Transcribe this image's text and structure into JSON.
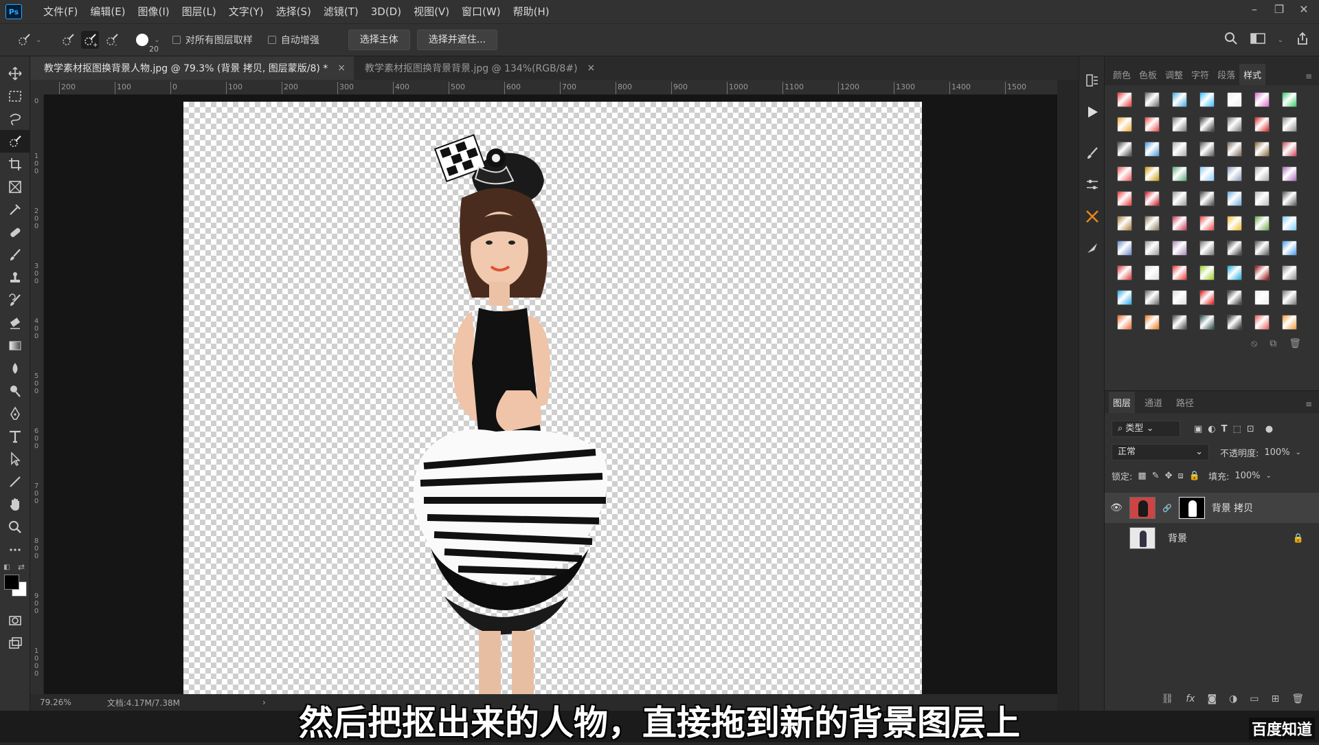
{
  "app": {
    "logo": "Ps"
  },
  "menu": [
    "文件(F)",
    "编辑(E)",
    "图像(I)",
    "图层(L)",
    "文字(Y)",
    "选择(S)",
    "滤镜(T)",
    "3D(D)",
    "视图(V)",
    "窗口(W)",
    "帮助(H)"
  ],
  "options": {
    "brush_size": "20",
    "sample_all_layers": "对所有图层取样",
    "auto_enhance": "自动增强",
    "select_subject": "选择主体",
    "select_and_mask": "选择并遮住..."
  },
  "tabs": [
    {
      "title": "教学素材抠图换背景人物.jpg @ 79.3% (背景 拷贝, 图层蒙版/8) *",
      "close": "×"
    },
    {
      "title": "教学素材抠图换背景背景.jpg @ 134%(RGB/8#)",
      "close": "×"
    }
  ],
  "ruler_h": [
    "200",
    "100",
    "0",
    "100",
    "200",
    "300",
    "400",
    "500",
    "600",
    "700",
    "800",
    "900",
    "1000",
    "1100",
    "1200",
    "1300",
    "1400",
    "1500"
  ],
  "ruler_v": [
    "0",
    "100",
    "200",
    "300",
    "400",
    "500",
    "600",
    "700",
    "800",
    "900",
    "1000"
  ],
  "status": {
    "zoom": "79.26%",
    "doc": "文档:4.17M/7.38M",
    "arrow": "›"
  },
  "subtitle": "然后把抠出来的人物，直接拖到新的背景图层上",
  "watermark": "百度知道",
  "style_panel": {
    "tabs": [
      "颜色",
      "色板",
      "调整",
      "字符",
      "段落",
      "样式"
    ],
    "active": 5
  },
  "layers_panel": {
    "tabs": [
      "图层",
      "通道",
      "路径"
    ],
    "filter": "类型",
    "blend_mode": "正常",
    "opacity_label": "不透明度:",
    "opacity": "100%",
    "lock_label": "锁定:",
    "fill_label": "填充:",
    "fill": "100%",
    "layers": [
      {
        "name": "背景 拷贝",
        "visible": true,
        "selected": true
      },
      {
        "name": "背景",
        "visible": false,
        "locked": true
      }
    ],
    "footer_icons": [
      "link-icon",
      "fx-icon",
      "mask-icon",
      "adjust-icon",
      "folder-icon",
      "new-layer-icon",
      "trash-icon"
    ],
    "footer_fx": "fx"
  },
  "swatch_colors": [
    "#e33",
    "#666",
    "#4ad",
    "#3bf",
    "#eee",
    "#d6c",
    "#3c6",
    "#ea3",
    "#e44",
    "#777",
    "#333",
    "#777",
    "#d22",
    "#888",
    "#444",
    "#49d",
    "#aaa",
    "#555",
    "#765",
    "#863",
    "#c45",
    "#e55",
    "#c90",
    "#5a7",
    "#8cf",
    "#89b",
    "#aaa",
    "#a6b",
    "#e33",
    "#c12",
    "#999",
    "#444",
    "#6ad",
    "#bbb",
    "#555",
    "#a73",
    "#875",
    "#c35",
    "#e44",
    "#eb2",
    "#6a4",
    "#7cf",
    "#68c",
    "#999",
    "#a8b",
    "#777",
    "#333",
    "#555",
    "#49e",
    "#d33",
    "#ddd",
    "#e33",
    "#9c2",
    "#1ad",
    "#900",
    "#888",
    "#2ae",
    "#666",
    "#ddd",
    "#d11",
    "#333",
    "#eee",
    "#777",
    "#e62",
    "#e71",
    "#444",
    "#244",
    "#222",
    "#e55",
    "#e93"
  ]
}
